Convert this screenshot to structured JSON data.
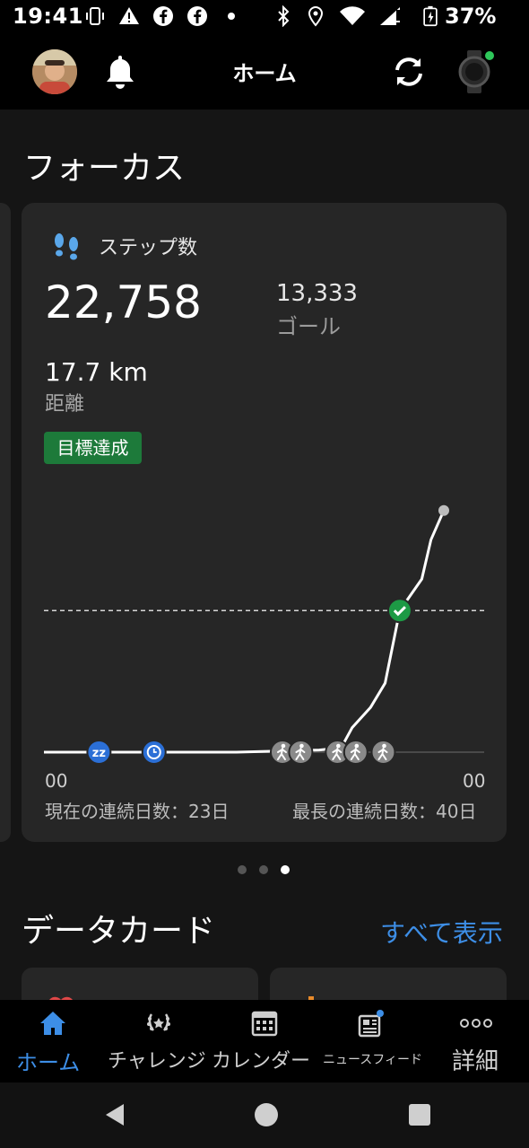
{
  "status_bar": {
    "time": "19:41",
    "battery": "37%",
    "icons": [
      "vibrate-icon",
      "alert-icon",
      "facebook-icon",
      "facebook-icon",
      "dot-icon",
      "bluetooth-icon",
      "location-icon",
      "wifi-icon",
      "signal-icon",
      "battery-charging-icon"
    ]
  },
  "header": {
    "title": "ホーム",
    "icons": [
      "avatar",
      "bell-icon",
      "sync-icon",
      "watch-icon"
    ]
  },
  "focus": {
    "title": "フォーカス"
  },
  "steps_card": {
    "label": "ステップ数",
    "steps": "22,758",
    "goal": "13,333",
    "goal_label": "ゴール",
    "distance": "17.7 km",
    "distance_label": "距離",
    "badge": "目標達成",
    "x_start": "00",
    "x_end": "00",
    "streak_current": "現在の連続日数：23日",
    "streak_best": "最長の連続日数：40日"
  },
  "chart_data": {
    "type": "line",
    "title": "",
    "xlabel": "",
    "ylabel": "",
    "x_tick_labels": [
      "00",
      "00"
    ],
    "series": [
      {
        "values": [
          {
            "x": 0,
            "y": 0
          },
          {
            "x": 7,
            "y": 0
          },
          {
            "x": 10.5,
            "y": 0
          },
          {
            "x": 15,
            "y": 200
          },
          {
            "x": 16.2,
            "y": 400
          },
          {
            "x": 16.8,
            "y": 2300
          },
          {
            "x": 17.8,
            "y": 4200
          },
          {
            "x": 18.6,
            "y": 6500
          },
          {
            "x": 19.4,
            "y": 13333
          },
          {
            "x": 20.6,
            "y": 16300
          },
          {
            "x": 21.1,
            "y": 20000
          },
          {
            "x": 21.8,
            "y": 22758
          }
        ]
      }
    ],
    "goal_line": 13333,
    "ylim": [
      0,
      24000
    ],
    "xlim": [
      0,
      24
    ],
    "markers": [
      {
        "icon": "sleep-icon",
        "x": 3
      },
      {
        "icon": "timer-icon",
        "x": 6
      },
      {
        "icon": "walk-icon",
        "x": 13
      },
      {
        "icon": "walk-icon",
        "x": 14
      },
      {
        "icon": "walk-icon",
        "x": 16
      },
      {
        "icon": "walk-icon",
        "x": 17
      },
      {
        "icon": "walk-icon",
        "x": 18.5
      }
    ],
    "goal_check_icon": "check-icon"
  },
  "pager": {
    "count": 3,
    "active": 3
  },
  "data_cards": {
    "title": "データカード",
    "view_all": "すべて表示"
  },
  "bottom_nav": {
    "items": [
      {
        "label": "ホーム",
        "icon": "home-icon",
        "active": true
      },
      {
        "label": "チャレンジ",
        "icon": "laurel-icon",
        "active": false
      },
      {
        "label": "カレンダー",
        "icon": "calendar-icon",
        "active": false
      },
      {
        "label": "ニュースフィード",
        "icon": "newsfeed-icon",
        "active": false
      },
      {
        "label": "詳細",
        "icon": "more-icon",
        "active": false
      }
    ]
  },
  "colors": {
    "accent": "#3d8ee6",
    "goal_green": "#1d7a3a",
    "card": "#262626",
    "background": "#151515"
  }
}
